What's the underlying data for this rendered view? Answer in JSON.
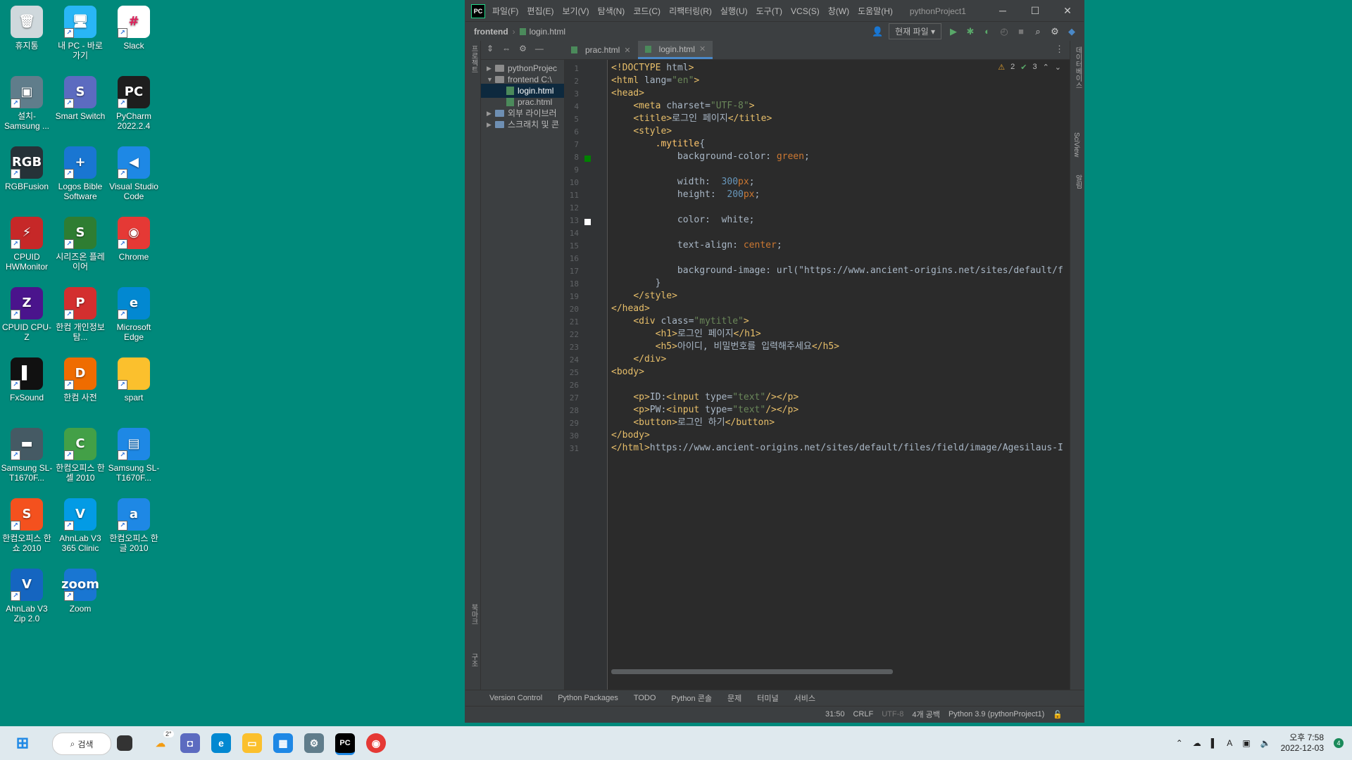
{
  "desktop": {
    "icons": [
      {
        "label": "휴지통",
        "glyph": "🗑",
        "color": "#cfd8dc"
      },
      {
        "label": "내 PC - 바로 가기",
        "glyph": "🖥",
        "color": "#29b6f6"
      },
      {
        "label": "Slack",
        "glyph": "#",
        "color": "#ffffff"
      },
      {
        "label": "설치-Samsung ...",
        "glyph": "▣",
        "color": "#607d8b"
      },
      {
        "label": "Smart Switch",
        "glyph": "S",
        "color": "#5c6bc0"
      },
      {
        "label": "PyCharm 2022.2.4",
        "glyph": "PC",
        "color": "#1e1e1e"
      },
      {
        "label": "RGBFusion",
        "glyph": "RGB",
        "color": "#263238"
      },
      {
        "label": "Logos Bible Software",
        "glyph": "+",
        "color": "#1976d2"
      },
      {
        "label": "Visual Studio Code",
        "glyph": "◀",
        "color": "#1e88e5"
      },
      {
        "label": "CPUID HWMonitor",
        "glyph": "⚡",
        "color": "#c62828"
      },
      {
        "label": "시리즈온 플레이어",
        "glyph": "S",
        "color": "#2e7d32"
      },
      {
        "label": "Chrome",
        "glyph": "◉",
        "color": "#e53935"
      },
      {
        "label": "CPUID CPU-Z",
        "glyph": "Z",
        "color": "#4a148c"
      },
      {
        "label": "한컴 개인정보탐...",
        "glyph": "P",
        "color": "#d32f2f"
      },
      {
        "label": "Microsoft Edge",
        "glyph": "e",
        "color": "#0288d1"
      },
      {
        "label": "FxSound",
        "glyph": "▌",
        "color": "#111111"
      },
      {
        "label": "한컴 사전",
        "glyph": "D",
        "color": "#ef6c00"
      },
      {
        "label": "spart",
        "glyph": "",
        "color": "#fbc02d"
      },
      {
        "label": "Samsung SL-T1670F...",
        "glyph": "▬",
        "color": "#455a64"
      },
      {
        "label": "한컴오피스 한셀 2010",
        "glyph": "C",
        "color": "#43a047"
      },
      {
        "label": "Samsung SL-T1670F...",
        "glyph": "▤",
        "color": "#1e88e5"
      },
      {
        "label": "한컴오피스 한쇼 2010",
        "glyph": "S",
        "color": "#f4511e"
      },
      {
        "label": "AhnLab V3 365 Clinic",
        "glyph": "V",
        "color": "#039be5"
      },
      {
        "label": "한컴오피스 한글 2010",
        "glyph": "a",
        "color": "#1e88e5"
      },
      {
        "label": "AhnLab V3 Zip 2.0",
        "glyph": "V",
        "color": "#1565c0"
      },
      {
        "label": "Zoom",
        "glyph": "zoom",
        "color": "#1976d2"
      }
    ]
  },
  "ide": {
    "logo": "PC",
    "menu": [
      "파일(F)",
      "편집(E)",
      "보기(V)",
      "탐색(N)",
      "코드(C)",
      "리팩터링(R)",
      "실행(U)",
      "도구(T)",
      "VCS(S)",
      "창(W)",
      "도움말(H)"
    ],
    "project_title": "pythonProject1",
    "breadcrumb": {
      "folder": "frontend",
      "file": "login.html"
    },
    "run_config": "현재 파일",
    "tabs": [
      {
        "label": "prac.html",
        "active": false
      },
      {
        "label": "login.html",
        "active": true
      }
    ],
    "left_strip": {
      "project": "프로젝트",
      "bookmarks": "북마크",
      "structure": "구조"
    },
    "right_strip": {
      "database": "데이터베이스",
      "sciview": "SciView",
      "notifications": "알림"
    },
    "project_tree": [
      {
        "label": "pythonProjec",
        "indent": 1,
        "kind": "folder",
        "caret": "▶"
      },
      {
        "label": "frontend  C:\\",
        "indent": 1,
        "kind": "folder",
        "caret": "▼"
      },
      {
        "label": "login.html",
        "indent": 3,
        "kind": "file",
        "caret": "",
        "selected": true
      },
      {
        "label": "prac.html",
        "indent": 3,
        "kind": "file",
        "caret": ""
      },
      {
        "label": "외부 라이브러",
        "indent": 1,
        "kind": "lib",
        "caret": "▶"
      },
      {
        "label": "스크래치 및 콘",
        "indent": 1,
        "kind": "lib",
        "caret": "▶"
      }
    ],
    "inspections": {
      "warnings": "2",
      "ok": "3"
    },
    "code_lines": [
      "<!DOCTYPE html>",
      "<html lang=\"en\">",
      "<head>",
      "    <meta charset=\"UTF-8\">",
      "    <title>로그인 페이지</title>",
      "    <style>",
      "        .mytitle{",
      "            background-color: green;",
      "",
      "            width:  300px;",
      "            height:  200px;",
      "",
      "            color:  white;",
      "",
      "            text-align: center;",
      "",
      "            background-image: url(\"https://www.ancient-origins.net/sites/default/f",
      "        }",
      "    </style>",
      "</head>",
      "    <div class=\"mytitle\">",
      "        <h1>로그인 페이지</h1>",
      "        <h5>아이디, 비밀번호를 입력해주세요</h5>",
      "    </div>",
      "<body>",
      "",
      "    <p>ID:<input type=\"text\"/></p>",
      "    <p>PW:<input type=\"text\"/></p>",
      "    <button>로그인 하기</button>",
      "</body>",
      "</html>https://www.ancient-origins.net/sites/default/files/field/image/Agesilaus-I"
    ],
    "bottom_tools": [
      "Version Control",
      "Python Packages",
      "TODO",
      "Python 콘솔",
      "문제",
      "터미널",
      "서비스"
    ],
    "status": {
      "position": "31:50",
      "line_sep": "CRLF",
      "encoding": "UTF-8",
      "indent": "4개 공백",
      "interpreter": "Python 3.9 (pythonProject1)"
    }
  },
  "taskbar": {
    "search_label": "검색",
    "weather": "2°",
    "time": "오후 7:58",
    "date": "2022-12-03",
    "notif_count": "4",
    "ime": "A"
  }
}
